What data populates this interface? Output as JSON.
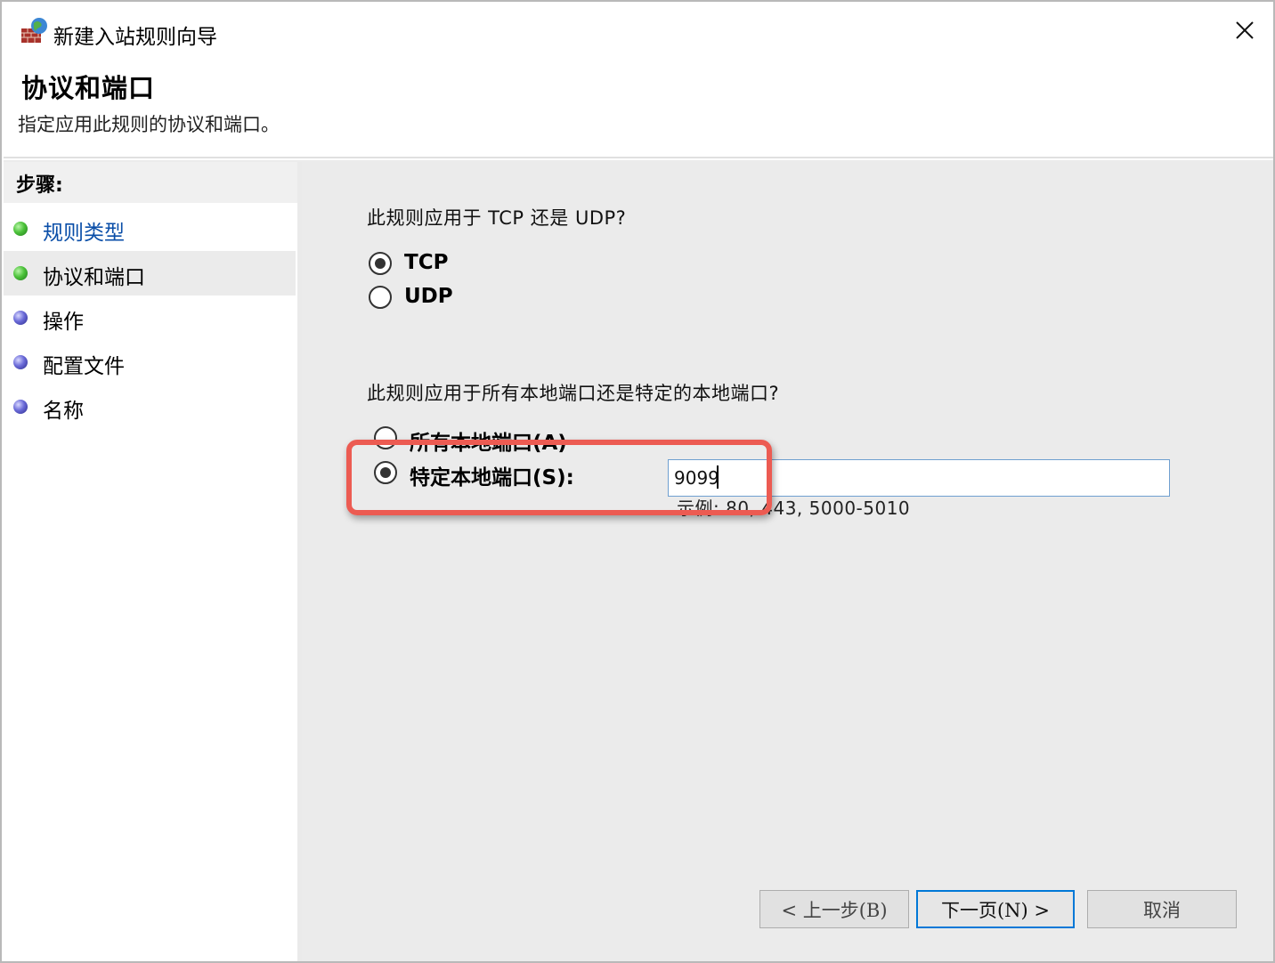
{
  "window": {
    "title": "新建入站规则向导",
    "close_icon": "close-icon"
  },
  "header": {
    "title": "协议和端口",
    "subtitle": "指定应用此规则的协议和端口。"
  },
  "sidebar": {
    "heading": "步骤:",
    "items": [
      {
        "label": "规则类型",
        "status": "completed",
        "color": "#4cc23a",
        "link": true
      },
      {
        "label": "协议和端口",
        "status": "current",
        "color": "#4cc23a",
        "link": false
      },
      {
        "label": "操作",
        "status": "pending",
        "color": "#6a6ad8",
        "link": false
      },
      {
        "label": "配置文件",
        "status": "pending",
        "color": "#6a6ad8",
        "link": false
      },
      {
        "label": "名称",
        "status": "pending",
        "color": "#6a6ad8",
        "link": false
      }
    ]
  },
  "main": {
    "protocol_question": "此规则应用于 TCP 还是 UDP?",
    "protocol_options": [
      {
        "label": "TCP",
        "checked": true
      },
      {
        "label": "UDP",
        "checked": false
      }
    ],
    "port_question": "此规则应用于所有本地端口还是特定的本地端口?",
    "port_options": [
      {
        "label": "所有本地端口(A)",
        "checked": false
      },
      {
        "label": "特定本地端口(S):",
        "checked": true
      }
    ],
    "port_value": "9099",
    "port_example": "示例: 80, 443, 5000-5010"
  },
  "highlight": {
    "color": "#ec5b52"
  },
  "buttons": {
    "back": "< 上一步(B)",
    "next": "下一页(N) >",
    "cancel": "取消"
  }
}
